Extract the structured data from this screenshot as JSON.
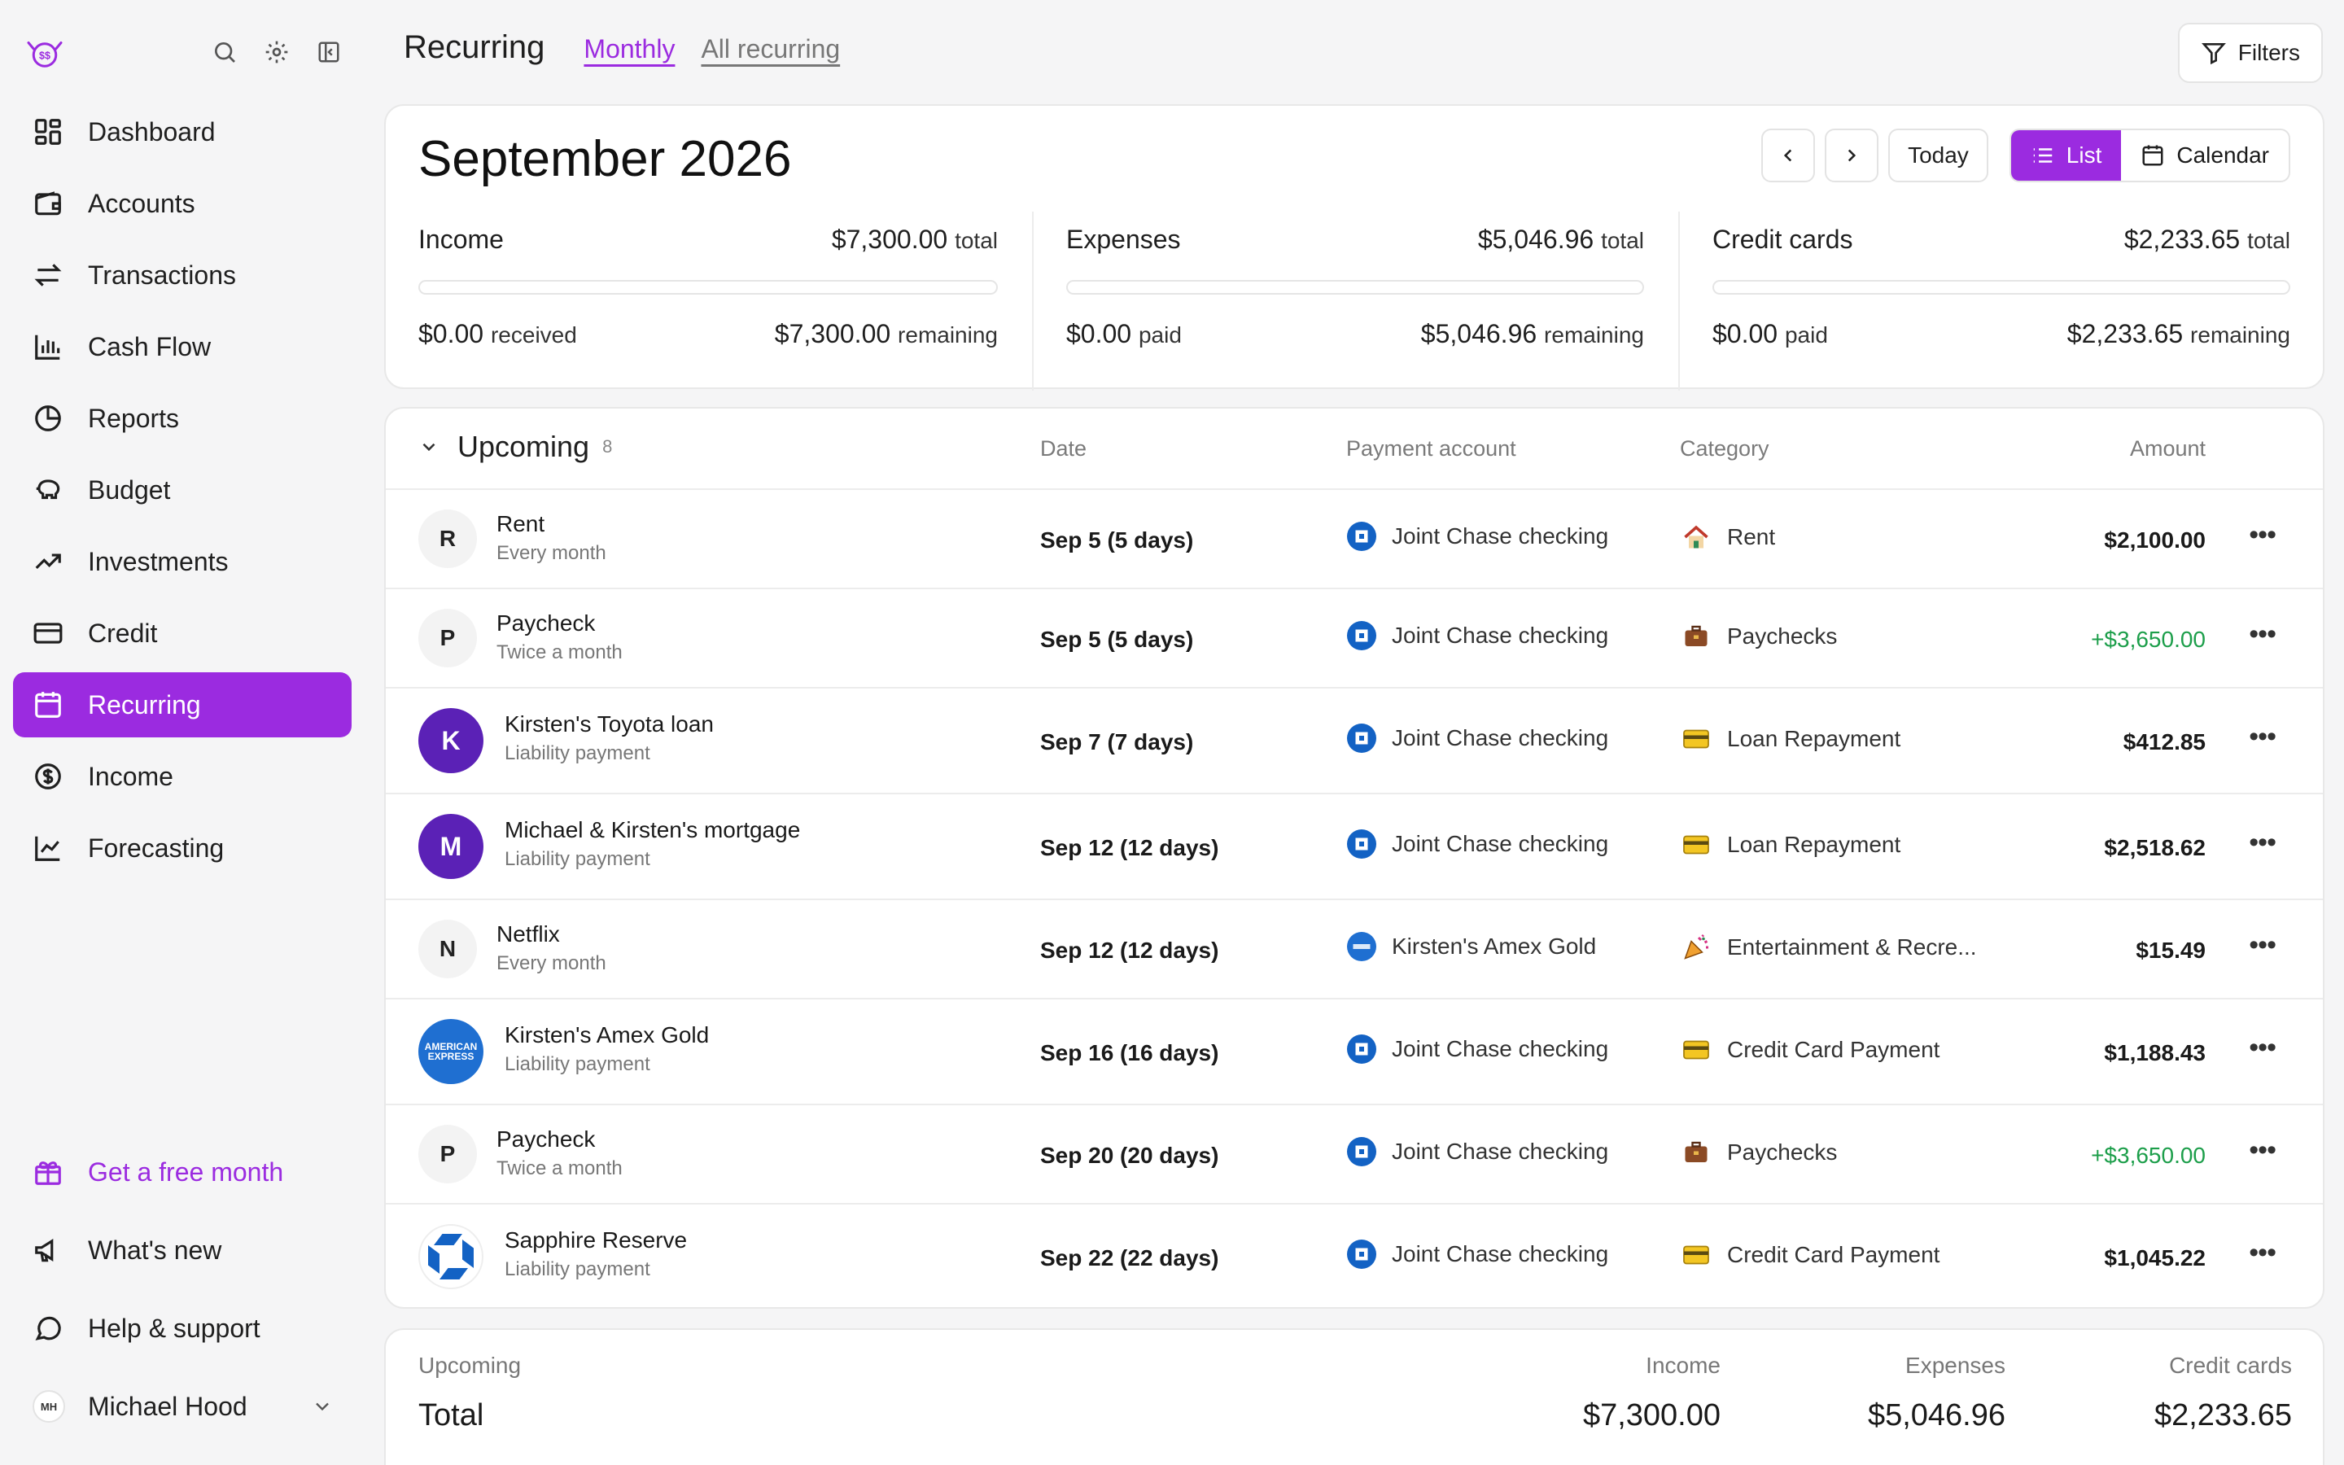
{
  "sidebar": {
    "items": [
      {
        "label": "Dashboard",
        "icon": "dashboard-icon"
      },
      {
        "label": "Accounts",
        "icon": "wallet-icon"
      },
      {
        "label": "Transactions",
        "icon": "arrows-icon"
      },
      {
        "label": "Cash Flow",
        "icon": "bar-chart-icon"
      },
      {
        "label": "Reports",
        "icon": "pie-icon"
      },
      {
        "label": "Budget",
        "icon": "piggy-icon"
      },
      {
        "label": "Investments",
        "icon": "trend-icon"
      },
      {
        "label": "Credit",
        "icon": "card-icon"
      },
      {
        "label": "Recurring",
        "icon": "calendar-icon"
      },
      {
        "label": "Income",
        "icon": "dollar-icon"
      },
      {
        "label": "Forecasting",
        "icon": "line-chart-icon"
      }
    ],
    "promo": "Get a free month",
    "whats_new": "What's new",
    "help": "Help & support",
    "user_initials": "MH",
    "user_name": "Michael Hood"
  },
  "topbar": {
    "title": "Recurring",
    "tab_monthly": "Monthly",
    "tab_all": "All recurring",
    "filters": "Filters"
  },
  "month": {
    "title": "September 2026",
    "today": "Today",
    "list": "List",
    "calendar": "Calendar",
    "income": {
      "label": "Income",
      "total": "$7,300.00",
      "total_suffix": "total",
      "left_val": "$0.00",
      "left_suffix": "received",
      "right_val": "$7,300.00",
      "right_suffix": "remaining",
      "progress": 0
    },
    "expenses": {
      "label": "Expenses",
      "total": "$5,046.96",
      "total_suffix": "total",
      "left_val": "$0.00",
      "left_suffix": "paid",
      "right_val": "$5,046.96",
      "right_suffix": "remaining",
      "progress": 0
    },
    "credit": {
      "label": "Credit cards",
      "total": "$2,233.65",
      "total_suffix": "total",
      "left_val": "$0.00",
      "left_suffix": "paid",
      "right_val": "$2,233.65",
      "right_suffix": "remaining",
      "progress": 0
    }
  },
  "list": {
    "section": "Upcoming",
    "count": "8",
    "columns": {
      "date": "Date",
      "account": "Payment account",
      "category": "Category",
      "amount": "Amount"
    },
    "rows": [
      {
        "initial": "R",
        "name": "Rent",
        "freq": "Every month",
        "date": "Sep 5 (5 days)",
        "account": "Joint Chase checking",
        "category": "Rent",
        "amount": "$2,100.00"
      },
      {
        "initial": "P",
        "name": "Paycheck",
        "freq": "Twice a month",
        "date": "Sep 5 (5 days)",
        "account": "Joint Chase checking",
        "category": "Paychecks",
        "amount": "+$3,650.00"
      },
      {
        "initial": "K",
        "name": "Kirsten's Toyota loan",
        "freq": "Liability payment",
        "date": "Sep 7 (7 days)",
        "account": "Joint Chase checking",
        "category": "Loan Repayment",
        "amount": "$412.85"
      },
      {
        "initial": "M",
        "name": "Michael & Kirsten's mortgage",
        "freq": "Liability payment",
        "date": "Sep 12 (12 days)",
        "account": "Joint Chase checking",
        "category": "Loan Repayment",
        "amount": "$2,518.62"
      },
      {
        "initial": "N",
        "name": "Netflix",
        "freq": "Every month",
        "date": "Sep 12 (12 days)",
        "account": "Kirsten's Amex Gold",
        "category": "Entertainment & Recre...",
        "amount": "$15.49"
      },
      {
        "initial": "AMERICAN EXPRESS",
        "name": "Kirsten's Amex Gold",
        "freq": "Liability payment",
        "date": "Sep 16 (16 days)",
        "account": "Joint Chase checking",
        "category": "Credit Card Payment",
        "amount": "$1,188.43"
      },
      {
        "initial": "P",
        "name": "Paycheck",
        "freq": "Twice a month",
        "date": "Sep 20 (20 days)",
        "account": "Joint Chase checking",
        "category": "Paychecks",
        "amount": "+$3,650.00"
      },
      {
        "initial": "",
        "name": "Sapphire Reserve",
        "freq": "Liability payment",
        "date": "Sep 22 (22 days)",
        "account": "Joint Chase checking",
        "category": "Credit Card Payment",
        "amount": "$1,045.22"
      }
    ]
  },
  "totals": {
    "section": "Upcoming",
    "label": "Total",
    "income_label": "Income",
    "income": "$7,300.00",
    "expenses_label": "Expenses",
    "expenses": "$5,046.96",
    "credit_label": "Credit cards",
    "credit": "$2,233.65"
  },
  "colors": {
    "accent": "#9b2be0",
    "positive": "#1c9e4a"
  }
}
